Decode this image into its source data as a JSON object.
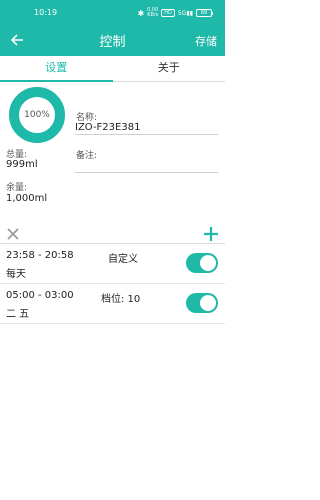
{
  "status_bar": {
    "time": "10:19",
    "speed": "0.00\nKB/s",
    "volte": "HD",
    "network": "5G",
    "battery": "89"
  },
  "app_bar": {
    "title": "控制",
    "save_label": "存储"
  },
  "tabs": [
    {
      "label": "设置",
      "active": true
    },
    {
      "label": "关于",
      "active": false
    }
  ],
  "gauge": {
    "percent_text": "100%",
    "level": 1.0
  },
  "fields": {
    "name_label": "名称:",
    "name_value": "IZO-F23E381",
    "note_label": "备注:",
    "note_value": "",
    "total_label": "总量:",
    "total_value": "999ml",
    "remaining_label": "余量:",
    "remaining_value": "1,000ml"
  },
  "schedules": [
    {
      "time": "23:58 - 20:58",
      "mode": "自定义",
      "days": "每天",
      "enabled": true
    },
    {
      "time": "05:00 - 03:00",
      "mode": "档位:  10",
      "days": "二 五",
      "enabled": true
    }
  ],
  "colors": {
    "accent": "#1fb9a9"
  },
  "icons": {
    "back": "arrow-left-icon",
    "delete": "close-icon",
    "add": "plus-icon"
  }
}
